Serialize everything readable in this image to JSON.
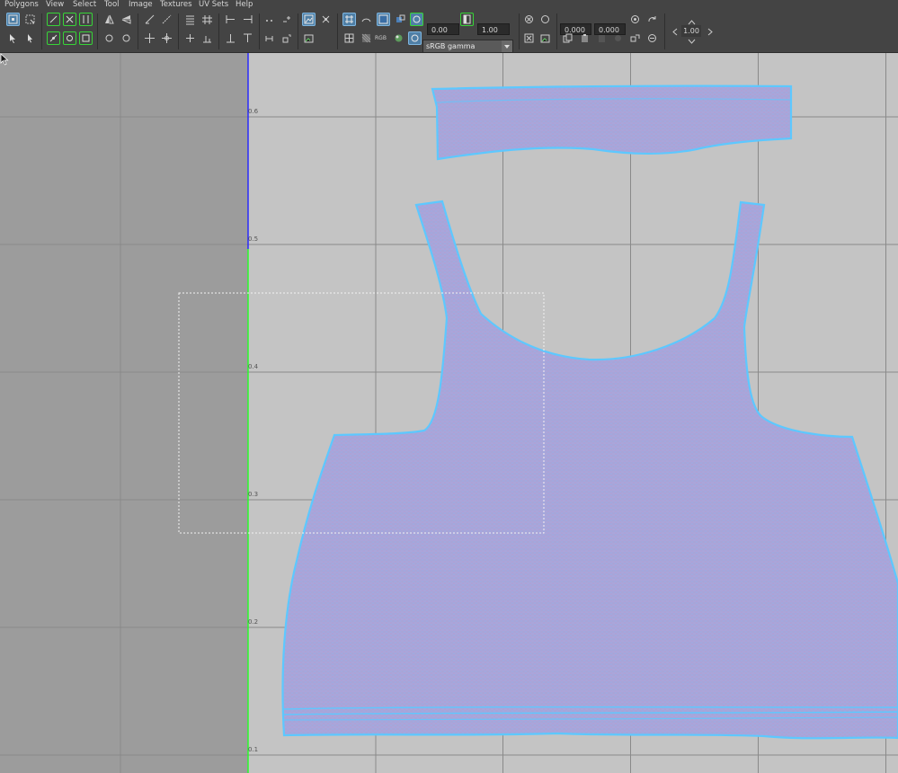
{
  "menu": {
    "items": [
      "Polygons",
      "View",
      "Select",
      "Tool",
      "Image",
      "Textures",
      "UV Sets",
      "Help"
    ]
  },
  "toolbar": {
    "field_value_min": "0.00",
    "field_value_max": "1.00",
    "color_space": "sRGB gamma",
    "coord_u": "0.000",
    "coord_v": "0.000",
    "zoom_value": "1.00",
    "rgb_label": "RGB"
  },
  "viewport": {
    "tick_labels": [
      "0.6",
      "0.5",
      "0.4",
      "0.3",
      "0.2",
      "0.1"
    ],
    "colors": {
      "background": "#c4c4c4",
      "outside_uv": "#9c9c9c",
      "grid": "#8a8a8a",
      "uv_fill": "#a9a4d6",
      "uv_edge": "#5dc8ff",
      "u_axis": "#22ff22",
      "v_axis": "#2222ff"
    }
  }
}
